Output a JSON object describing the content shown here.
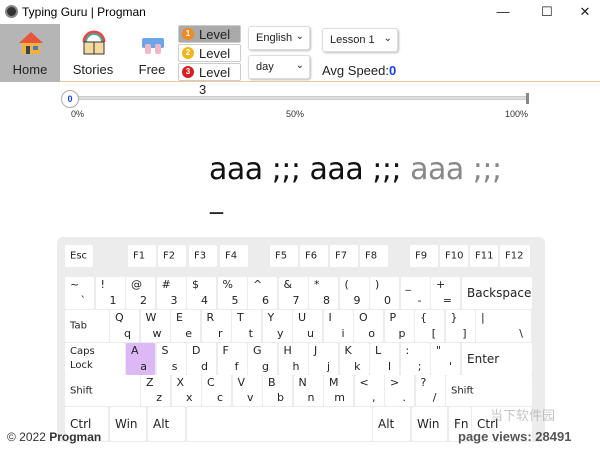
{
  "window": {
    "title": "Typing Guru | Progman",
    "minimize": "—",
    "maximize": "☐",
    "close": "✕"
  },
  "toolbar": {
    "nav": [
      {
        "label": "Home",
        "icon": "house-icon",
        "active": true
      },
      {
        "label": "Stories",
        "icon": "book-icon"
      },
      {
        "label": "Free",
        "icon": "keyboard-hands-icon"
      }
    ],
    "levels": [
      {
        "label": "Level 1",
        "badge": "1",
        "color": "#f08a1c",
        "active": true
      },
      {
        "label": "Level 2",
        "badge": "2",
        "color": "#f2b51c"
      },
      {
        "label": "Level 3",
        "badge": "3",
        "color": "#d42020"
      }
    ],
    "language": "English",
    "lesson": "Lesson 1",
    "theme": "day",
    "avg_speed_label": "Avg Speed:",
    "avg_speed_value": "0"
  },
  "progress": {
    "value": 0,
    "thumb_label": "0",
    "labels": [
      "0%",
      "50%",
      "100%"
    ]
  },
  "typing": {
    "typed": "aaa ;;; aaa ;;; ",
    "remaining": "aaa ;;;",
    "cursor": "_"
  },
  "keyboard": {
    "frow": [
      "Esc",
      "F1",
      "F2",
      "F3",
      "F4",
      "F5",
      "F6",
      "F7",
      "F8",
      "F9",
      "F10",
      "F11",
      "F12"
    ],
    "row1": [
      [
        "~",
        "`"
      ],
      [
        "!",
        "1"
      ],
      [
        "@",
        "2"
      ],
      [
        "#",
        "3"
      ],
      [
        "$",
        "4"
      ],
      [
        "%",
        "5"
      ],
      [
        "^",
        "6"
      ],
      [
        "&",
        "7"
      ],
      [
        "*",
        "8"
      ],
      [
        "(",
        "9"
      ],
      [
        ")",
        "0"
      ],
      [
        "_",
        "-"
      ],
      [
        "+",
        "="
      ]
    ],
    "backspace": "Backspace",
    "tab": "Tab",
    "row2": [
      [
        "Q",
        "q"
      ],
      [
        "W",
        "w"
      ],
      [
        "E",
        "e"
      ],
      [
        "R",
        "r"
      ],
      [
        "T",
        "t"
      ],
      [
        "Y",
        "y"
      ],
      [
        "U",
        "u"
      ],
      [
        "I",
        "i"
      ],
      [
        "O",
        "o"
      ],
      [
        "P",
        "p"
      ],
      [
        "{",
        "["
      ],
      [
        "}",
        "]"
      ],
      [
        "|",
        "\\"
      ]
    ],
    "caps": "Caps Lock",
    "row3": [
      [
        "A",
        "a"
      ],
      [
        "S",
        "s"
      ],
      [
        "D",
        "d"
      ],
      [
        "F",
        "f"
      ],
      [
        "G",
        "g"
      ],
      [
        "H",
        "h"
      ],
      [
        "J",
        "j"
      ],
      [
        "K",
        "k"
      ],
      [
        "L",
        "l"
      ],
      [
        ":",
        ";"
      ],
      [
        "\"",
        "'"
      ]
    ],
    "enter": "Enter",
    "shift": "Shift",
    "row4": [
      [
        "Z",
        "z"
      ],
      [
        "X",
        "x"
      ],
      [
        "C",
        "c"
      ],
      [
        "V",
        "v"
      ],
      [
        "B",
        "b"
      ],
      [
        "N",
        "n"
      ],
      [
        "M",
        "m"
      ],
      [
        "<",
        ","
      ],
      [
        ">",
        "."
      ],
      [
        "?",
        "/"
      ]
    ],
    "bottom": [
      "Ctrl",
      "Win",
      "Alt",
      "",
      "Alt",
      "Win",
      "Fn",
      "Ctrl"
    ],
    "active_key": "a",
    "highlight_color": "#dcb8f5"
  },
  "footer": {
    "copyright": "© 2022",
    "brand": "Progman",
    "page_views": "page views: 28491"
  },
  "watermark": "当下软件园"
}
